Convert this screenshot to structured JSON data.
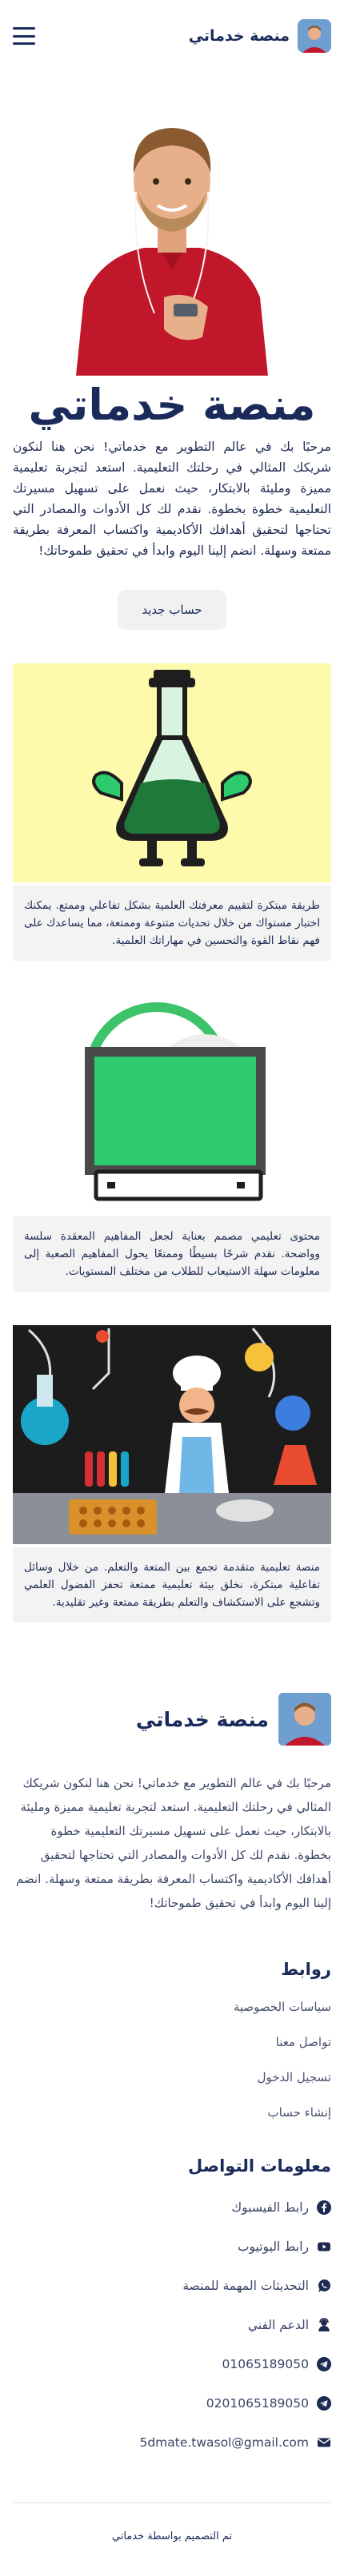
{
  "header": {
    "site_name": "منصة خدماتي",
    "menu_icon": "hamburger-icon",
    "logo": "profile-avatar"
  },
  "hero": {
    "title": "منصة خدماتي",
    "text": "مرحبًا بك في عالم التطوير مع خدماتي! نحن هنا لنكون شريكك المثالي في رحلتك التعليمية. استعد لتجربة تعليمية مميزة ومليئة بالابتكار، حيث نعمل على تسهيل مسيرتك التعليمية خطوة بخطوة. نقدم لك كل الأدوات والمصادر التي تحتاجها لتحقيق أهدافك الأكاديمية واكتساب المعرفة بطريقة ممتعة وسهلة. انضم إلينا اليوم وابدأ في تحقيق طموحاتك!",
    "cta_label": "حساب جديد"
  },
  "features": [
    {
      "image": "flask-illustration",
      "caption": "طريقة مبتكرة لتقييم معرفتك العلمية بشكل تفاعلي وممتع. يمكنك اختبار مستواك من خلال تحديات متنوعة وممتعة، مما يساعدك على فهم نقاط القوة والتحسين في مهاراتك العلمية."
    },
    {
      "image": "monitor-illustration",
      "caption": "محتوى تعليمي مصمم بعناية لجعل المفاهيم المعقدة سلسة وواضحة. نقدم شرحًا بسيطًا وممتعًا يحول المفاهيم الصعبة إلى معلومات سهلة الاستيعاب للطلاب من مختلف المستويات."
    },
    {
      "image": "chef-lab-illustration",
      "caption": "منصة تعليمية متقدمة تجمع بين المتعة والتعلم. من خلال وسائل تفاعلية مبتكرة، نخلق بيئة تعليمية ممتعة تحفز الفضول العلمي وتشجع على الاستكشاف والتعلم بطريقة ممتعة وغير تقليدية."
    }
  ],
  "footer": {
    "site_name": "منصة خدماتي",
    "about": "مرحبًا بك في عالم التطوير مع خدماتي! نحن هنا لنكون شريكك المثالي في رحلتك التعليمية. استعد لتجربة تعليمية مميزة ومليئة بالابتكار، حيث نعمل على تسهيل مسيرتك التعليمية خطوة بخطوة. نقدم لك كل الأدوات والمصادر التي تحتاجها لتحقيق أهدافك الأكاديمية واكتساب المعرفة بطريقة ممتعة وسهلة. انضم إلينا اليوم وابدأ في تحقيق طموحاتك!",
    "links_title": "روابط",
    "links": [
      "سياسات الخصوصية",
      "تواصل معنا",
      "تسجيل الدخول",
      "إنشاء حساب"
    ],
    "contact_title": "معلومات التواصل",
    "contacts": [
      {
        "icon": "facebook-icon",
        "label": "رابط الفيسبوك"
      },
      {
        "icon": "youtube-icon",
        "label": "رابط اليوتيوب"
      },
      {
        "icon": "whatsapp-icon",
        "label": "التحديثات المهمة للمنصة"
      },
      {
        "icon": "support-agent-icon",
        "label": "الدعم الفني"
      },
      {
        "icon": "telegram-icon",
        "label": "01065189050"
      },
      {
        "icon": "telegram-icon",
        "label": "0201065189050"
      },
      {
        "icon": "envelope-icon",
        "label": "5dmate.twasol@gmail.com"
      }
    ],
    "credit": "تم التصميم بواسطة خدماتي"
  },
  "colors": {
    "primary": "#1a2a5a",
    "card_bg": "#f3f3f3",
    "button_bg": "#f1f1f1",
    "shirt": "#c0172b",
    "flask_bg": "#fdfaac",
    "monitor_screen": "#2dcb6e"
  }
}
